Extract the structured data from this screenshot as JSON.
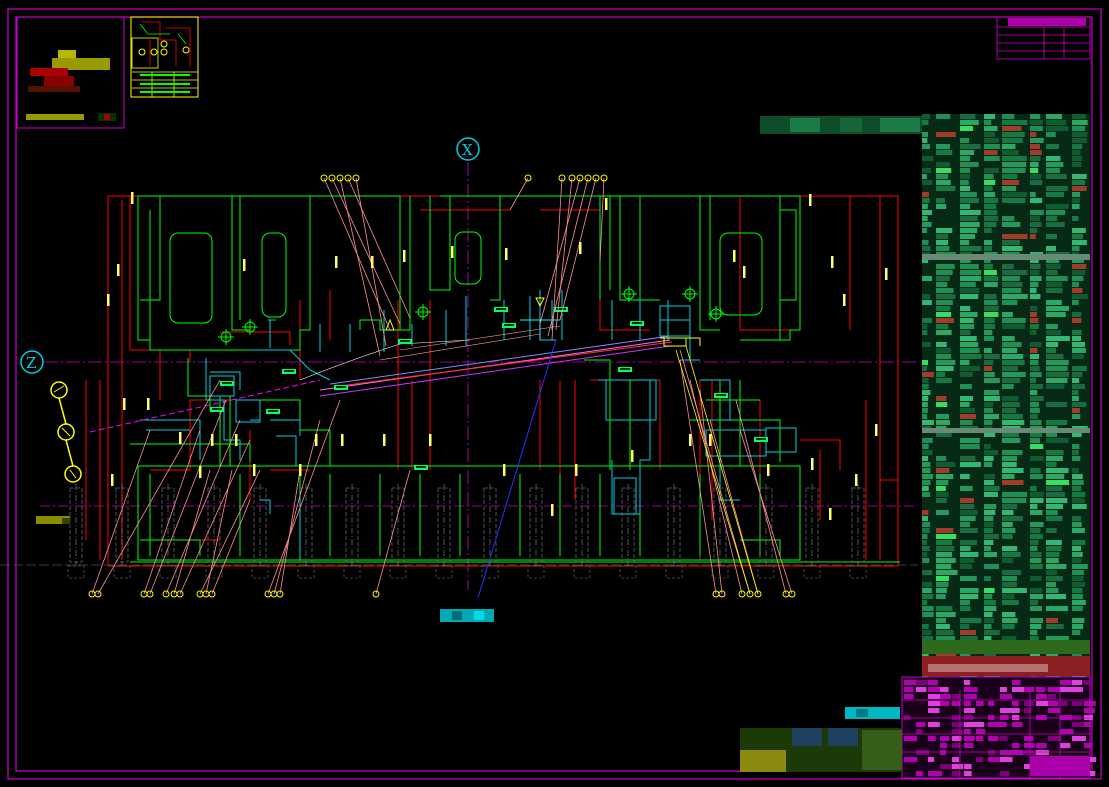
{
  "drawing": {
    "markers": {
      "x_marker": "X",
      "z_marker": "Z"
    },
    "colors": {
      "background": "#000000",
      "frame": "#cc00cc",
      "structure": "#00ff00",
      "dimension": "#ff0000",
      "pipe": "#00cfe0",
      "center_line": "#cc00cc",
      "leader": "#ff8a8a",
      "balloon": "#ffff00"
    },
    "callout_count_top": 12,
    "callout_count_bottom": 17
  }
}
